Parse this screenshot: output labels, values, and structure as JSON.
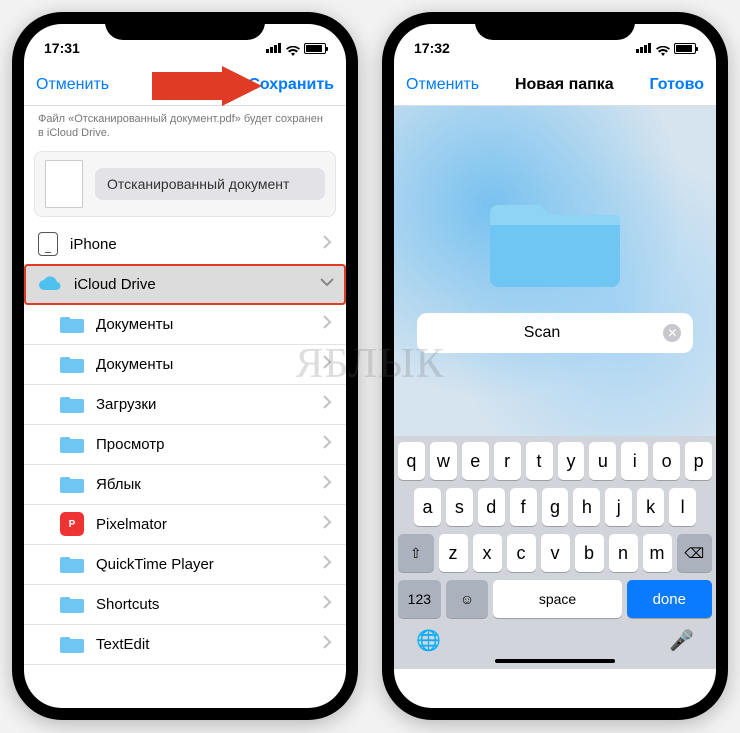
{
  "watermark": "ЯБЛЫК",
  "left": {
    "status": {
      "time": "17:31"
    },
    "nav": {
      "cancel": "Отменить",
      "save": "Сохранить"
    },
    "hint_l1": "Файл «Отсканированный документ.pdf» будет сохранен",
    "hint_l2": "в iCloud Drive.",
    "doc_label": "Отсканированный документ",
    "locations": {
      "iphone": "iPhone",
      "icloud": "iCloud Drive"
    },
    "folders": [
      {
        "name": "Документы",
        "icon": "folder"
      },
      {
        "name": "Документы",
        "icon": "folder"
      },
      {
        "name": "Загрузки",
        "icon": "folder"
      },
      {
        "name": "Просмотр",
        "icon": "folder"
      },
      {
        "name": "Яблык",
        "icon": "folder"
      },
      {
        "name": "Pixelmator",
        "icon": "app"
      },
      {
        "name": "QuickTime Player",
        "icon": "folder"
      },
      {
        "name": "Shortcuts",
        "icon": "folder"
      },
      {
        "name": "TextEdit",
        "icon": "folder"
      }
    ]
  },
  "right": {
    "status": {
      "time": "17:32"
    },
    "nav": {
      "cancel": "Отменить",
      "title": "Новая папка",
      "done": "Готово"
    },
    "folder_name": "Scan",
    "keyboard": {
      "row1": [
        "q",
        "w",
        "e",
        "r",
        "t",
        "y",
        "u",
        "i",
        "o",
        "p"
      ],
      "row2": [
        "a",
        "s",
        "d",
        "f",
        "g",
        "h",
        "j",
        "k",
        "l"
      ],
      "row3": [
        "z",
        "x",
        "c",
        "v",
        "b",
        "n",
        "m"
      ],
      "numkey": "123",
      "space": "space",
      "done": "done"
    }
  }
}
